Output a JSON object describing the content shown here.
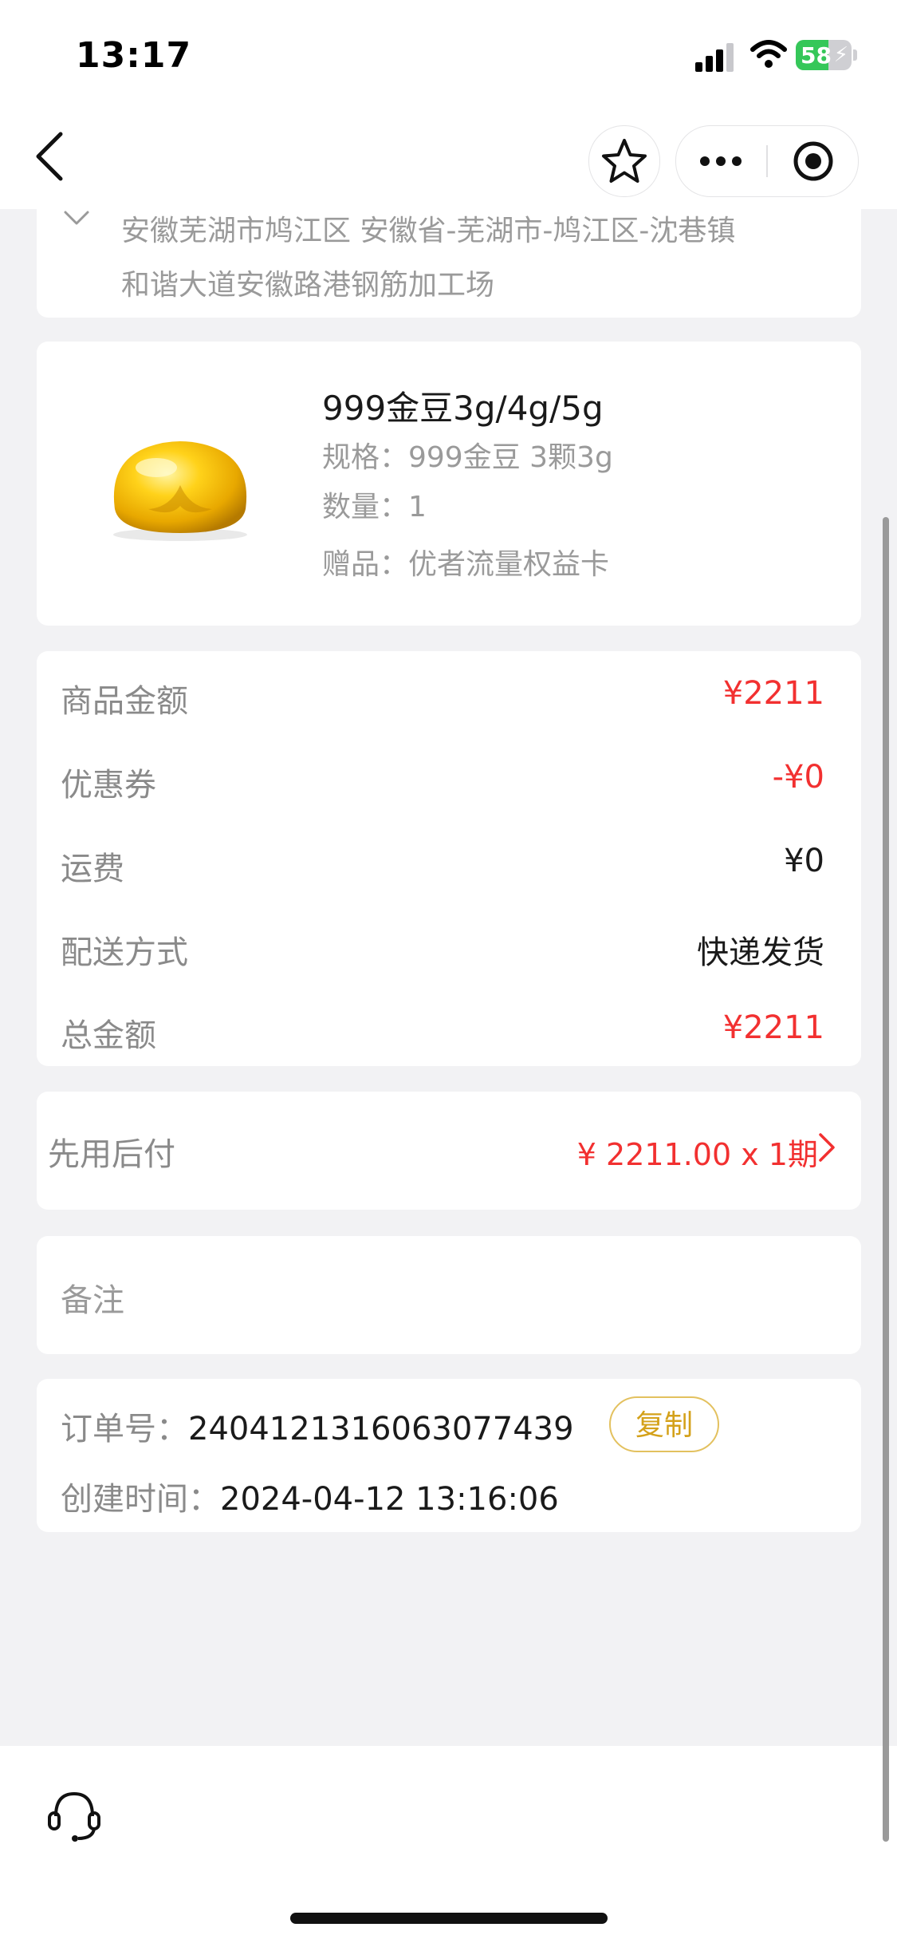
{
  "status_bar": {
    "time": "13:17",
    "battery": "58",
    "battery_level": 0.58
  },
  "address": {
    "line1": "安徽芜湖市鸠江区 安徽省-芜湖市-鸠江区-沈巷镇",
    "line2": "和谐大道安徽路港钢筋加工场"
  },
  "product": {
    "title": "999金豆3g/4g/5g",
    "spec": "规格：999金豆 3颗3g",
    "quantity": "数量：1",
    "gift": "赠品：优者流量权益卡"
  },
  "price": {
    "rows": [
      {
        "label": "商品金额",
        "value": "¥2211",
        "color": "#f23030"
      },
      {
        "label": "优惠券",
        "value": "-¥0",
        "color": "#f23030"
      },
      {
        "label": "运费",
        "value": "¥0",
        "color": "#1a1a1a"
      },
      {
        "label": "配送方式",
        "value": "快递发货",
        "color": "#1a1a1a"
      },
      {
        "label": "总金额",
        "value": "¥2211",
        "color": "#f23030"
      }
    ]
  },
  "payment": {
    "label": "先用后付",
    "value": "¥ 2211.00 x 1期"
  },
  "note": {
    "label": "备注"
  },
  "order": {
    "number_label": "订单号：",
    "number": "240412131606307743​9",
    "copy_label": "复制",
    "created_label": "创建时间：",
    "created": "2024-04-12 13:16:06"
  },
  "icons": [
    "back-icon",
    "star-icon",
    "more-icon",
    "close-mini-program-icon",
    "chevron-down-icon",
    "chevron-right-icon",
    "customer-service-icon"
  ]
}
